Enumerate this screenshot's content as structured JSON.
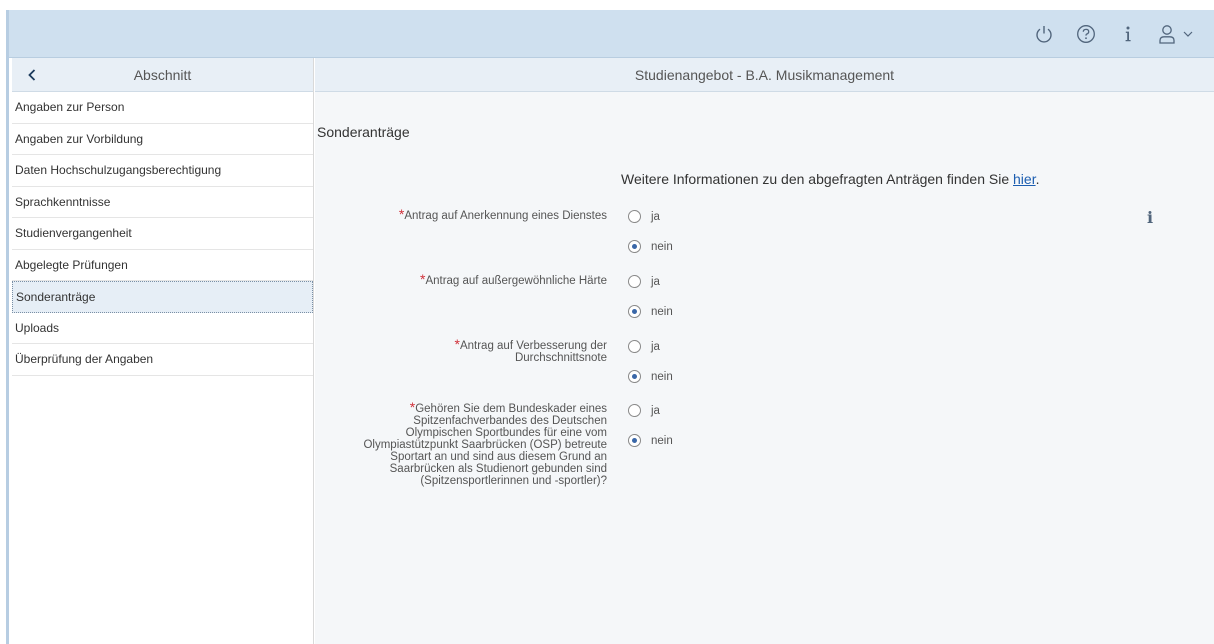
{
  "shell": {
    "icons": [
      "power-icon",
      "help-icon",
      "info-icon",
      "user-icon",
      "chevron-down-icon"
    ],
    "colors": {
      "bar": "#cfe0ef",
      "icon": "#51657c",
      "link": "#1b5db0",
      "required": "#d0313a"
    }
  },
  "sidebar": {
    "title": "Abschnitt",
    "items": [
      {
        "label": "Angaben zur Person"
      },
      {
        "label": "Angaben zur Vorbildung"
      },
      {
        "label": "Daten Hochschulzugangsberechtigung"
      },
      {
        "label": "Sprachkenntnisse"
      },
      {
        "label": "Studienvergangenheit"
      },
      {
        "label": "Abgelegte Prüfungen"
      },
      {
        "label": "Sonderanträge",
        "selected": true
      },
      {
        "label": "Uploads"
      },
      {
        "label": "Überprüfung der Angaben"
      }
    ]
  },
  "main": {
    "header": "Studienangebot - B.A. Musikmanagement",
    "section_title": "Sonderanträge",
    "info_text": "Weitere Informationen zu den abgefragten Anträgen finden Sie ",
    "info_link": "hier",
    "info_end": ".",
    "required_mark": "*",
    "option_yes": "ja",
    "option_no": "nein",
    "fields": [
      {
        "label": "Antrag auf Anerkennung eines Dienstes",
        "value": "nein"
      },
      {
        "label": "Antrag auf außergewöhnliche Härte",
        "value": "nein"
      },
      {
        "label_lines": [
          "Antrag auf Verbesserung der",
          "Durchschnittsnote"
        ],
        "value": "nein"
      },
      {
        "label_lines": [
          "Gehören Sie dem Bundeskader eines",
          "Spitzenfachverbandes des Deutschen",
          "Olympischen Sportbundes für eine vom",
          "Olympiastützpunkt Saarbrücken (OSP) betreute",
          "Sportart an und sind aus diesem Grund an",
          "Saarbrücken als Studienort gebunden sind",
          "(Spitzensportlerinnen und -sportler)?"
        ],
        "value": "nein"
      }
    ]
  }
}
